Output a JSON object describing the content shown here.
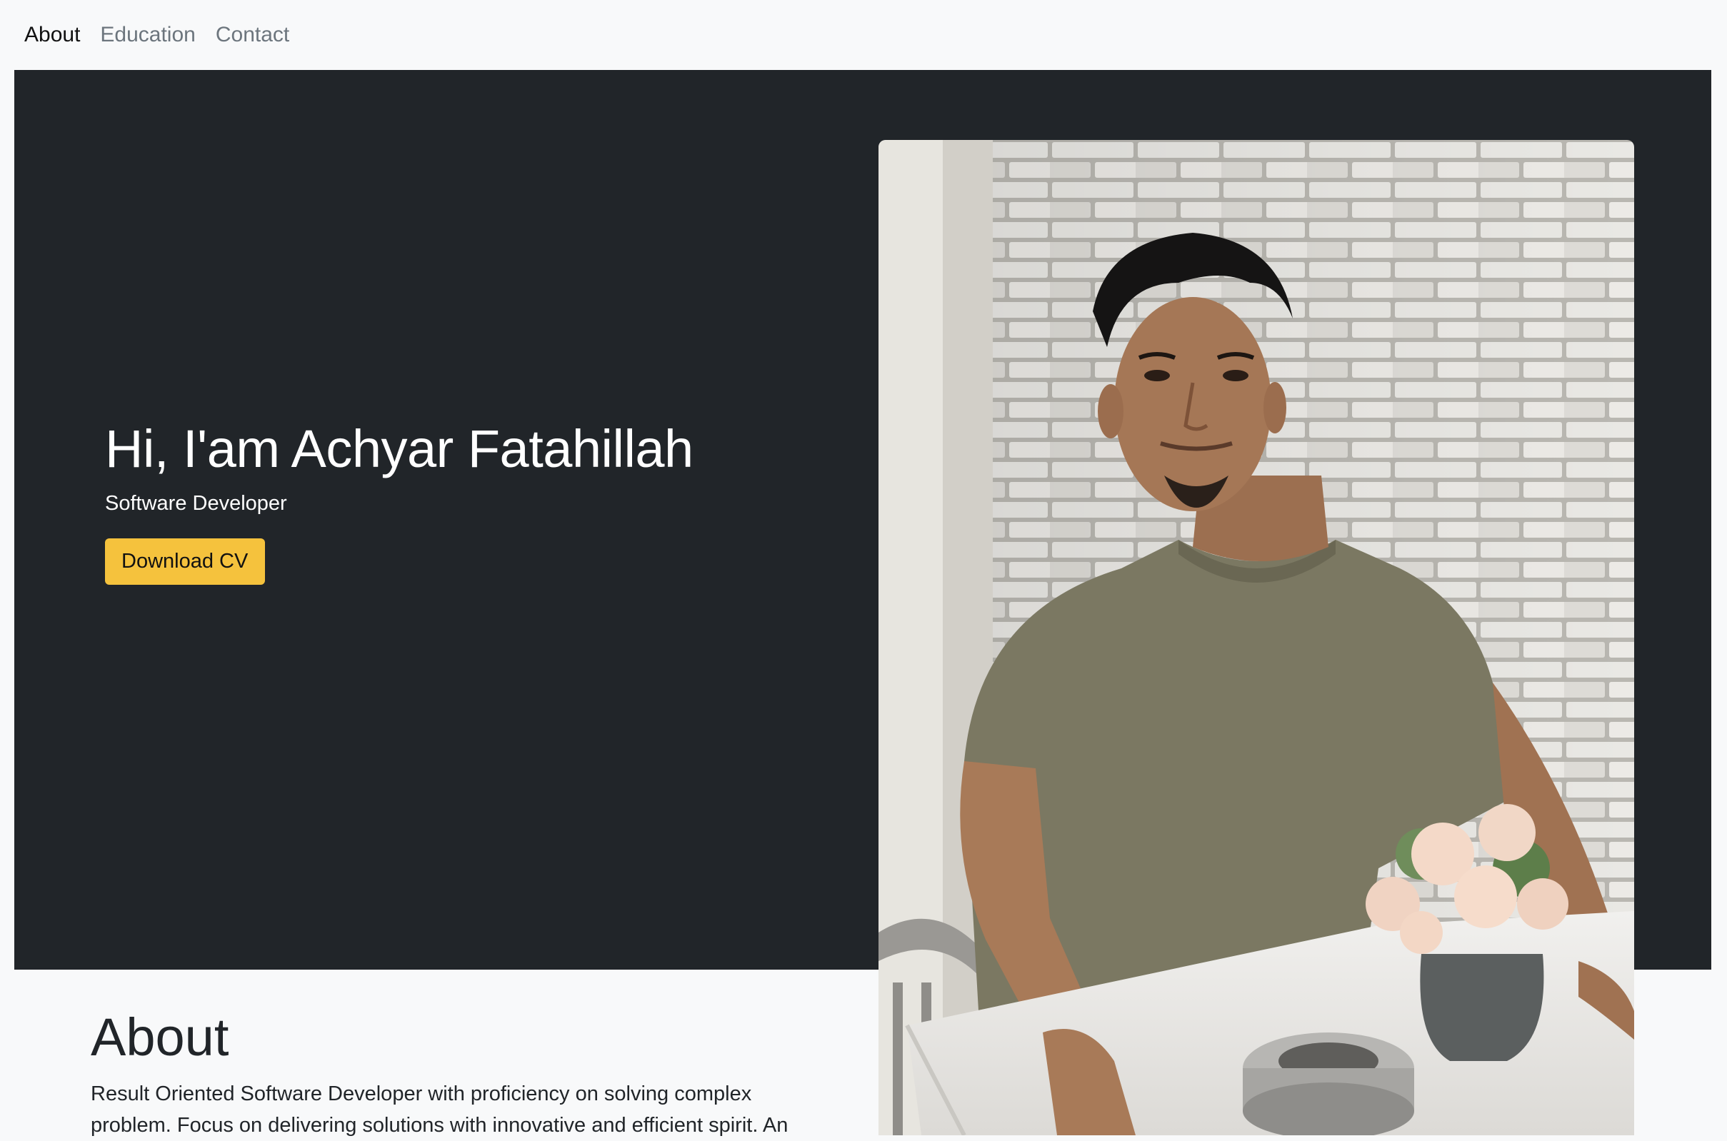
{
  "nav": {
    "items": [
      {
        "label": "About",
        "active": true
      },
      {
        "label": "Education",
        "active": false
      },
      {
        "label": "Contact",
        "active": false
      }
    ]
  },
  "hero": {
    "title": "Hi, I'am Achyar Fatahillah",
    "subtitle": "Software Developer",
    "button_label": "Download CV",
    "background_color": "#212529",
    "button_color": "#f5c23d"
  },
  "about": {
    "title": "About",
    "text": "Result Oriented Software Developer with proficiency on solving complex problem. Focus on delivering solutions with innovative and efficient spirit. An"
  }
}
